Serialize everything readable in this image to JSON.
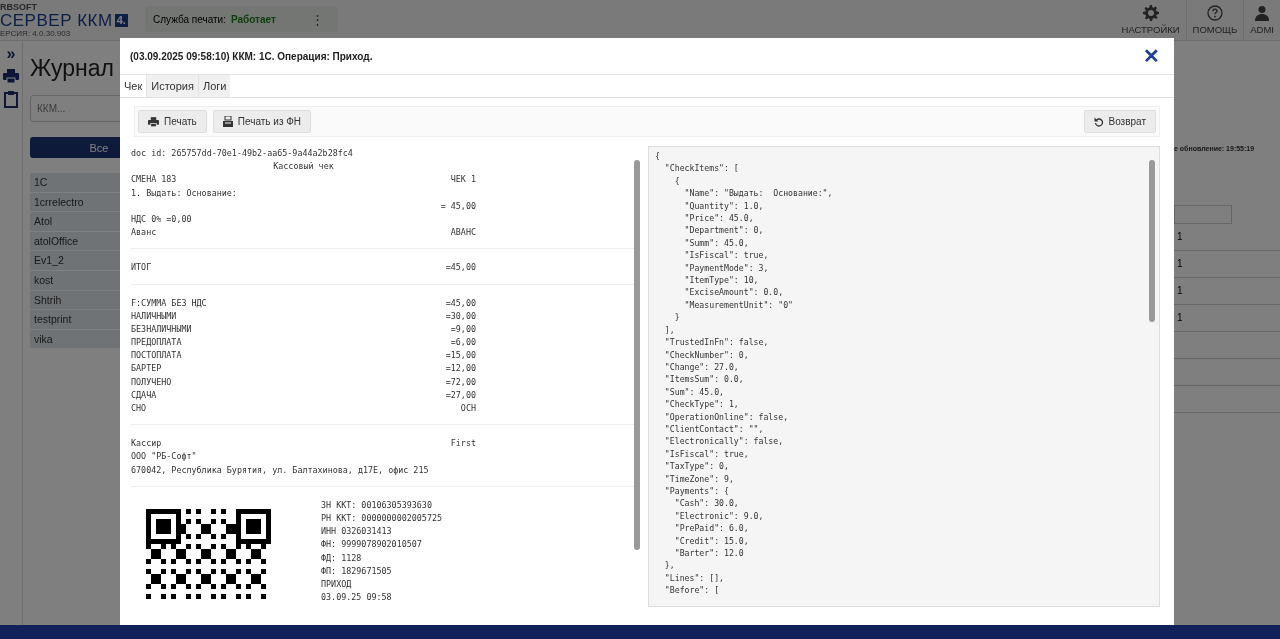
{
  "header": {
    "brand_top": "RBSOFT",
    "brand": "СЕРВЕР ККМ",
    "brand_badge": "4.",
    "version": "ЕРСИЯ: 4.0.30.903",
    "service_label": "Служба печати:",
    "service_status": "Работает",
    "menu_glyph": "⋮",
    "nav": [
      {
        "kind": "settings",
        "label": "НАСТРОЙКИ"
      },
      {
        "kind": "help",
        "label": "ПОМОЩЬ"
      },
      {
        "kind": "user",
        "label": "ADMI"
      }
    ]
  },
  "rail": {
    "expand_glyph": "»",
    "items": [
      {
        "kind": "printer"
      },
      {
        "kind": "clipboard"
      }
    ]
  },
  "page": {
    "title": "Журнал",
    "search": {
      "placeholder": "ККМ..."
    },
    "all_button": {
      "label": "Все",
      "selected": true
    },
    "kkm_list": [
      "1C",
      "1crrelectro",
      "Atol",
      "atolOffice",
      "Ev1_2",
      "kost",
      "Shtrih",
      "testprint",
      "vika"
    ],
    "last_update": "е обновление: 19:55:19",
    "rows": [
      {
        "cell": "1"
      },
      {
        "cell": "1"
      },
      {
        "cell": "1"
      },
      {
        "cell": "1"
      },
      {
        "cell": ""
      },
      {
        "cell": ""
      },
      {
        "cell": ""
      }
    ]
  },
  "modal": {
    "title": "(03.09.2025 09:58:10) ККМ: 1С. Операция: Приход.",
    "close_glyph": "✕",
    "tabs": [
      {
        "label": "Чек",
        "selected": true
      },
      {
        "label": "История",
        "selected": false
      },
      {
        "label": "Логи",
        "selected": false
      }
    ],
    "toolbar": [
      {
        "kind": "print",
        "label": "Печать"
      },
      {
        "kind": "print-fn",
        "label": "Печать из ФН"
      },
      {
        "kind": "return",
        "label": "Возврат"
      }
    ],
    "receipt": {
      "sections": [
        {
          "lines": [
            {
              "kind": "text",
              "text": "doc id: 265757dd-70e1-49b2-aa65-9a44a2b28fc4"
            },
            {
              "kind": "center",
              "text": "Кассовый чек"
            },
            {
              "kind": "pair",
              "left": "СМЕНА 183",
              "right": "ЧЕК 1"
            },
            {
              "kind": "text",
              "text": "1. Выдать: Основание:"
            },
            {
              "kind": "right",
              "text": "= 45,00"
            },
            {
              "kind": "text",
              "text": "НДС 0% =0,00"
            },
            {
              "kind": "pair",
              "left": "Аванс",
              "right": "АВАНС"
            }
          ]
        },
        {
          "lines": [
            {
              "kind": "pair",
              "left": "ИТОГ",
              "right": "=45,00"
            }
          ]
        },
        {
          "lines": [
            {
              "kind": "pair",
              "left": "F:СУММА БЕЗ НДС",
              "right": "=45,00"
            },
            {
              "kind": "pair",
              "left": "НАЛИЧНЫМИ",
              "right": "=30,00"
            },
            {
              "kind": "pair",
              "left": "БЕЗНАЛИЧНЫМИ",
              "right": "=9,00"
            },
            {
              "kind": "pair",
              "left": "ПРЕДОПЛАТА",
              "right": "=6,00"
            },
            {
              "kind": "pair",
              "left": "ПОСТОПЛАТА",
              "right": "=15,00"
            },
            {
              "kind": "pair",
              "left": "БАРТЕР",
              "right": "=12,00"
            },
            {
              "kind": "pair",
              "left": "ПОЛУЧЕНО",
              "right": "=72,00"
            },
            {
              "kind": "pair",
              "left": "СДАЧА",
              "right": "=27,00"
            },
            {
              "kind": "pair",
              "left": "СНО",
              "right": "ОСН"
            }
          ]
        },
        {
          "lines": [
            {
              "kind": "pair",
              "left": "Кассир",
              "right": "First"
            },
            {
              "kind": "text",
              "text": "ООО \"РБ-Софт\""
            },
            {
              "kind": "text",
              "text": "670042, Республика Бурятия, ул. Балтахинова, д17Е, офис 215"
            }
          ]
        }
      ],
      "fiscal_lines": [
        "ЗН ККТ: 00106305393630",
        "РН ККТ: 0000000002005725",
        "ИНН 0326031413",
        "ФН: 9999078902010507",
        "ФД: 1128",
        "ФП: 1829671505",
        "ПРИХОД",
        "03.09.25 09:58"
      ]
    },
    "json_lines": [
      "{",
      "  \"CheckItems\": [",
      "    {",
      "      \"Name\": \"Выдать:  Основание:\",",
      "      \"Quantity\": 1.0,",
      "      \"Price\": 45.0,",
      "      \"Department\": 0,",
      "      \"Summ\": 45.0,",
      "      \"IsFiscal\": true,",
      "      \"PaymentMode\": 3,",
      "      \"ItemType\": 10,",
      "      \"ExciseAmount\": 0.0,",
      "      \"MeasurementUnit\": \"0\"",
      "    }",
      "  ],",
      "  \"TrustedInFn\": false,",
      "  \"CheckNumber\": 0,",
      "  \"Change\": 27.0,",
      "  \"ItemsSum\": 0.0,",
      "  \"Sum\": 45.0,",
      "  \"CheckType\": 1,",
      "  \"OperationOnline\": false,",
      "  \"ClientContact\": \"\",",
      "  \"Electronically\": false,",
      "  \"IsFiscal\": true,",
      "  \"TaxType\": 0,",
      "  \"TimeZone\": 9,",
      "  \"Payments\": {",
      "    \"Cash\": 30.0,",
      "    \"Electronic\": 9.0,",
      "    \"PrePaid\": 6.0,",
      "    \"Credit\": 15.0,",
      "    \"Barter\": 12.0",
      "  },",
      "  \"Lines\": [],",
      "  \"Before\": ["
    ]
  }
}
